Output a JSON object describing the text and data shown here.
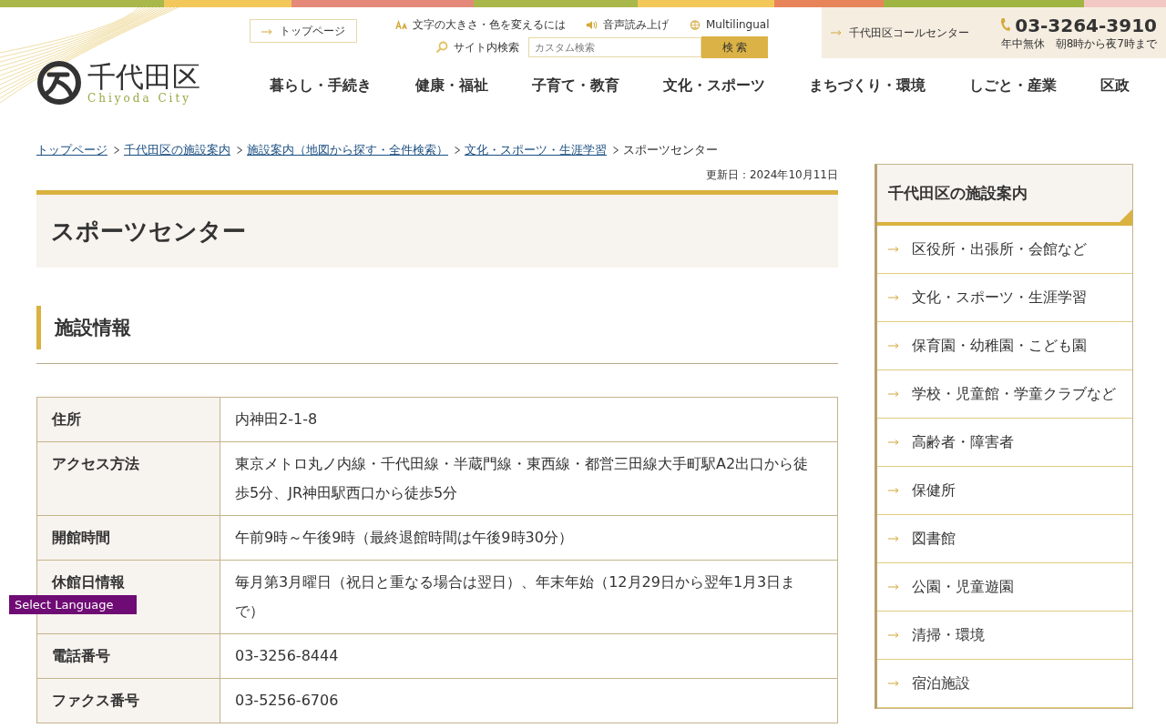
{
  "header": {
    "logo": {
      "name": "千代田区",
      "sub": "Chiyoda City"
    },
    "top_link": "トップページ",
    "tools": [
      "文字の大きさ・色を変えるには",
      "音声読み上げ",
      "Multilingual"
    ],
    "search": {
      "label": "サイト内検索",
      "placeholder": "カスタム検索",
      "button": "検 索"
    },
    "call_center": {
      "label": "千代田区コールセンター",
      "phone": "03-3264-3910",
      "hours": "年中無休　朝8時から夜7時まで"
    }
  },
  "nav": [
    "暮らし・手続き",
    "健康・福祉",
    "子育て・教育",
    "文化・スポーツ",
    "まちづくり・環境",
    "しごと・産業",
    "区政"
  ],
  "breadcrumb": [
    {
      "label": "トップページ",
      "current": false
    },
    {
      "label": "千代田区の施設案内",
      "current": false
    },
    {
      "label": "施設案内（地図から探す・全件検索）",
      "current": false
    },
    {
      "label": "文化・スポーツ・生涯学習",
      "current": false
    },
    {
      "label": "スポーツセンター",
      "current": true
    }
  ],
  "updated": "更新日：2024年10月11日",
  "title": "スポーツセンター",
  "section": "施設情報",
  "table": {
    "rows": [
      {
        "label": "住所",
        "value": "内神田2-1-8"
      },
      {
        "label": "アクセス方法",
        "value": "東京メトロ丸ノ内線・千代田線・半蔵門線・東西線・都営三田線大手町駅A2出口から徒歩5分、JR神田駅西口から徒歩5分"
      },
      {
        "label": "開館時間",
        "value": "午前9時～午後9時（最終退館時間は午後9時30分）"
      },
      {
        "label": "休館日情報",
        "value": "毎月第3月曜日（祝日と重なる場合は翌日）、年末年始（12月29日から翌年1月3日まで）"
      },
      {
        "label": "電話番号",
        "value": "03-3256-8444"
      },
      {
        "label": "ファクス番号",
        "value": "03-5256-6706"
      }
    ]
  },
  "sidebar": {
    "title": "千代田区の施設案内",
    "items": [
      "区役所・出張所・会館など",
      "文化・スポーツ・生涯学習",
      "保育園・幼稚園・こども園",
      "学校・児童館・学童クラブなど",
      "高齢者・障害者",
      "保健所",
      "図書館",
      "公園・児童遊園",
      "清掃・環境",
      "宿泊施設"
    ]
  },
  "language_button": "Select Language"
}
